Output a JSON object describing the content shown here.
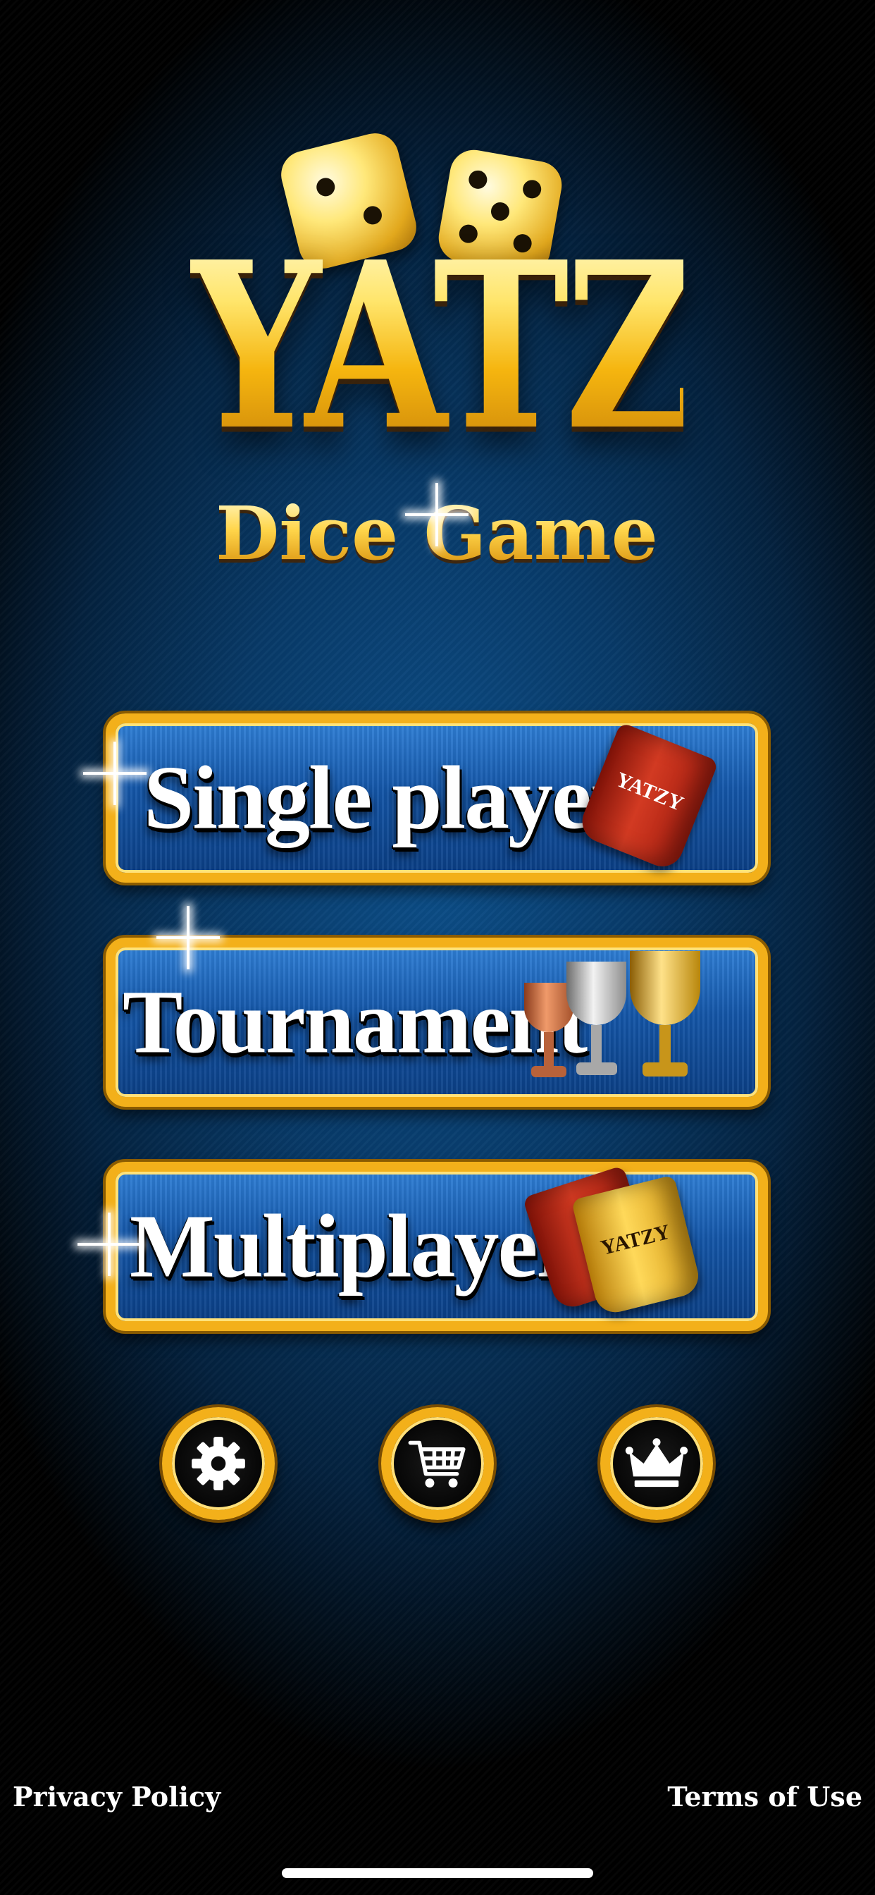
{
  "logo": {
    "title": "YATZY",
    "subtitle": "Dice Game"
  },
  "menu": {
    "single_player": "Single player",
    "tournament": "Tournament",
    "multiplayer": "Multiplayer",
    "cup_text": "YATZY"
  },
  "icons": {
    "settings": "gear-icon",
    "shop": "cart-icon",
    "leaderboard": "crown-icon"
  },
  "footer": {
    "privacy": "Privacy Policy",
    "terms": "Terms of Use"
  },
  "colors": {
    "gold": "#f3b01a",
    "button_blue": "#1456a8",
    "background": "#083a68"
  }
}
